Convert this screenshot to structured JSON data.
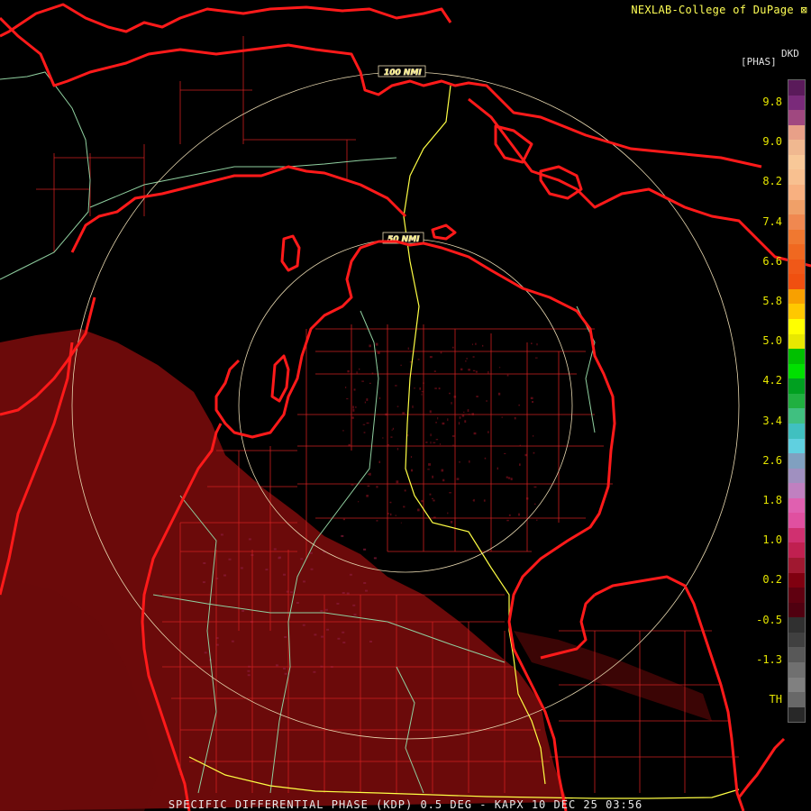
{
  "header": {
    "credit": "NEXLAB-College of DuPage",
    "credit_mark": "⊠"
  },
  "caption": "SPECIFIC DIFFERENTIAL PHASE (KDP) 0.5 DEG - KAPX 10 DEC 25 03:56",
  "rings": {
    "inner_label": "50 NMI",
    "outer_label": "100 NMI"
  },
  "legend": {
    "product": "DKD",
    "unit": "[PHAS]",
    "ticks": [
      "9.8",
      "9.0",
      "8.2",
      "7.4",
      "6.6",
      "5.8",
      "5.0",
      "4.2",
      "3.4",
      "2.6",
      "1.8",
      "1.0",
      "0.2",
      "-0.5",
      "-1.3",
      "TH"
    ],
    "colors": [
      "#5a1a5a",
      "#7a2a7a",
      "#a04880",
      "#e8a088",
      "#f0b890",
      "#f8c898",
      "#f8c090",
      "#f8b080",
      "#f0a068",
      "#f08850",
      "#f07830",
      "#f06820",
      "#f05818",
      "#f05010",
      "#f8a000",
      "#ffc800",
      "#ffff00",
      "#e8e800",
      "#00c000",
      "#00e000",
      "#00a020",
      "#20b040",
      "#40c080",
      "#40c0c0",
      "#60d0e0",
      "#80a0c0",
      "#a090c0",
      "#c080c0",
      "#e060b0",
      "#e050a0",
      "#d03070",
      "#c02050",
      "#a01830",
      "#800010",
      "#600010",
      "#500010",
      "#303030",
      "#404040",
      "#585858",
      "#707070",
      "#808080",
      "#686868",
      "#282828"
    ],
    "tick_color": "#e6e600"
  },
  "map_colors": {
    "radar_echo": "#6b0a0a",
    "coastline": "#ff1a1a",
    "county_lines": "#cc2020",
    "state_lines": "#90d0a0",
    "highways": "#ffff44",
    "range_rings": "#e8d8b0"
  }
}
